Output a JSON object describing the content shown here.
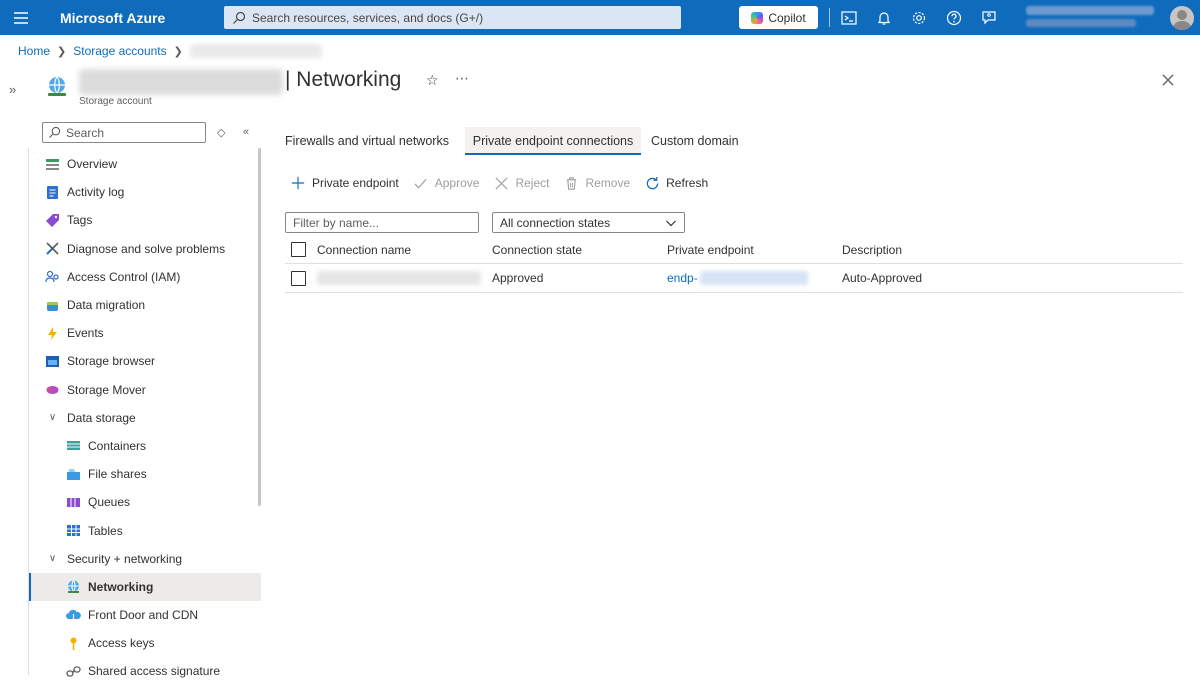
{
  "topbar": {
    "brand": "Microsoft Azure",
    "search_placeholder": "Search resources, services, and docs (G+/)",
    "copilot_label": "Copilot",
    "icons": [
      "cloud-shell-icon",
      "notifications-icon",
      "settings-icon",
      "help-icon",
      "feedback-icon"
    ]
  },
  "breadcrumb": {
    "home": "Home",
    "storage_accounts": "Storage accounts"
  },
  "resource": {
    "title": "| Networking",
    "subtitle": "Storage account"
  },
  "nav": {
    "search_placeholder": "Search",
    "items": [
      {
        "label": "Overview",
        "icon": "overview-icon"
      },
      {
        "label": "Activity log",
        "icon": "activity-log-icon"
      },
      {
        "label": "Tags",
        "icon": "tags-icon"
      },
      {
        "label": "Diagnose and solve problems",
        "icon": "diagnose-icon"
      },
      {
        "label": "Access Control (IAM)",
        "icon": "iam-icon"
      },
      {
        "label": "Data migration",
        "icon": "data-migration-icon"
      },
      {
        "label": "Events",
        "icon": "events-icon"
      },
      {
        "label": "Storage browser",
        "icon": "storage-browser-icon"
      },
      {
        "label": "Storage Mover",
        "icon": "storage-mover-icon"
      }
    ],
    "group_data_storage": "Data storage",
    "data_storage_items": [
      {
        "label": "Containers",
        "icon": "containers-icon"
      },
      {
        "label": "File shares",
        "icon": "file-shares-icon"
      },
      {
        "label": "Queues",
        "icon": "queues-icon"
      },
      {
        "label": "Tables",
        "icon": "tables-icon"
      }
    ],
    "group_security": "Security + networking",
    "security_items": [
      {
        "label": "Networking",
        "icon": "networking-icon"
      },
      {
        "label": "Front Door and CDN",
        "icon": "front-door-icon"
      },
      {
        "label": "Access keys",
        "icon": "access-keys-icon"
      },
      {
        "label": "Shared access signature",
        "icon": "sas-icon"
      }
    ]
  },
  "tabs": [
    {
      "label": "Firewalls and virtual networks"
    },
    {
      "label": "Private endpoint connections"
    },
    {
      "label": "Custom domain"
    }
  ],
  "toolbar": {
    "add": "Private endpoint",
    "approve": "Approve",
    "reject": "Reject",
    "remove": "Remove",
    "refresh": "Refresh"
  },
  "filters": {
    "name_placeholder": "Filter by name...",
    "state_value": "All connection states"
  },
  "table": {
    "headers": [
      "Connection name",
      "Connection state",
      "Private endpoint",
      "Description"
    ],
    "rows": [
      {
        "state": "Approved",
        "endpoint_prefix": "endp-",
        "description": "Auto-Approved"
      }
    ]
  },
  "colors": {
    "accent": "#0f6cbd",
    "topbar": "#0f6cbd",
    "active_nav_bg": "#edebe9"
  }
}
